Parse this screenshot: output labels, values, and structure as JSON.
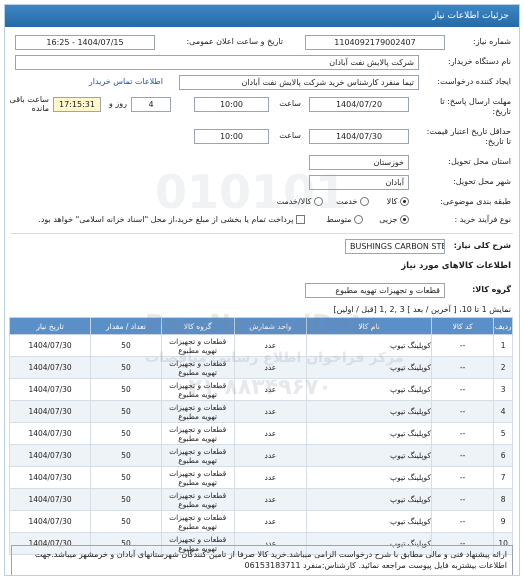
{
  "header": {
    "title": "جزئیات اطلاعات نیاز"
  },
  "fields": {
    "need_number_label": "شماره نیاز:",
    "need_number": "1104092179002407",
    "announce_label": "تاریخ و ساعت اعلان عمومی:",
    "announce_value": "1404/07/15 - 16:25",
    "buyer_label": "نام دستگاه خریدار:",
    "buyer_value": "شرکت پالایش نفت آبادان",
    "creator_label": "ایجاد کننده درخواست:",
    "creator_value": "تیما منفرد کارشناس خرید شرکت پالایش نفت آبادان",
    "contact_link": "اطلاعات تماس خریدار",
    "deadline_label": "مهلت ارسال پاسخ: تا تاریخ:",
    "deadline_date": "1404/07/20",
    "time_label": "ساعت",
    "deadline_time": "10:00",
    "days_value": "4",
    "days_label": "روز و",
    "remaining_time": "17:15:31",
    "remaining_label": "ساعت باقی مانده",
    "validity_label": "حداقل تاریخ اعتبار قیمت: تا تاریخ:",
    "validity_date": "1404/07/30",
    "validity_time": "10:00",
    "province_label": "استان محل تحویل:",
    "province_value": "خوزستان",
    "city_label": "شهر محل تحویل:",
    "city_value": "آبادان",
    "category_label": "طبقه بندی موضوعی:",
    "category_options": [
      "کالا",
      "خدمت",
      "کالا/خدمت"
    ],
    "process_label": "نوع فرآیند خرید :",
    "process_options": [
      "جزیی",
      "متوسط"
    ],
    "payment_note": "پرداخت تمام یا بخشی از مبلغ خرید،از محل \"اسناد خزانه اسلامی\" خواهد بود."
  },
  "summary": {
    "label": "شرح کلی نیاز:",
    "value": "BUSHINGS CARBON STEEL"
  },
  "goods_section": {
    "title": "اطلاعات کالاهای مورد نیاز",
    "group_label": "گروه کالا:",
    "group_value": "قطعات و تجهیزات تهویه مطبوع",
    "pager": "نمایش 1 تا 10، [ آخرین / بعد ] 3 ,2 ,1 [قبل / اولین]"
  },
  "table": {
    "headers": [
      "ردیف",
      "کد کالا",
      "نام کالا",
      "واحد شمارش",
      "گروه کالا",
      "تعداد / مقدار",
      "تاریخ نیاز"
    ],
    "rows": [
      [
        "1",
        "--",
        "کوپلینگ تیوپ",
        "عدد",
        "قطعات و تجهیزات تهویه مطبوع",
        "50",
        "1404/07/30"
      ],
      [
        "2",
        "--",
        "کوپلینگ تیوپ",
        "عدد",
        "قطعات و تجهیزات تهویه مطبوع",
        "50",
        "1404/07/30"
      ],
      [
        "3",
        "--",
        "کوپلینگ تیوپ",
        "عدد",
        "قطعات و تجهیزات تهویه مطبوع",
        "50",
        "1404/07/30"
      ],
      [
        "4",
        "--",
        "کوپلینگ تیوپ",
        "عدد",
        "قطعات و تجهیزات تهویه مطبوع",
        "50",
        "1404/07/30"
      ],
      [
        "5",
        "--",
        "کوپلینگ تیوپ",
        "عدد",
        "قطعات و تجهیزات تهویه مطبوع",
        "50",
        "1404/07/30"
      ],
      [
        "6",
        "--",
        "کوپلینگ تیوپ",
        "عدد",
        "قطعات و تجهیزات تهویه مطبوع",
        "50",
        "1404/07/30"
      ],
      [
        "7",
        "--",
        "کوپلینگ تیوپ",
        "عدد",
        "قطعات و تجهیزات تهویه مطبوع",
        "50",
        "1404/07/30"
      ],
      [
        "8",
        "--",
        "کوپلینگ تیوپ",
        "عدد",
        "قطعات و تجهیزات تهویه مطبوع",
        "50",
        "1404/07/30"
      ],
      [
        "9",
        "--",
        "کوپلینگ تیوپ",
        "عدد",
        "قطعات و تجهیزات تهویه مطبوع",
        "50",
        "1404/07/30"
      ],
      [
        "10",
        "--",
        "کوپلینگ تیوپ",
        "عدد",
        "قطعات و تجهیزات تهویه مطبوع",
        "50",
        "1404/07/30"
      ]
    ]
  },
  "description": "ارائه پیشنهاد فنی و مالی مطابق با شرح درخواست الزامی میباشد.خرید کالا صرفا از تامین کنندگان شهرستانهای آبادان و خرمشهر میباشد.جهت اطلاعات بیشتربه فایل پیوست مراجعه نمائید. کارشناس:منفرد 06153183711",
  "watermark": {
    "brand": "ParsNamadData",
    "line1": "مرکز فراخوان اطلاع رسانی مناقصات",
    "phone": "۰۲۱-۸۸۳۴۹۶۷۰",
    "code": "010101"
  }
}
